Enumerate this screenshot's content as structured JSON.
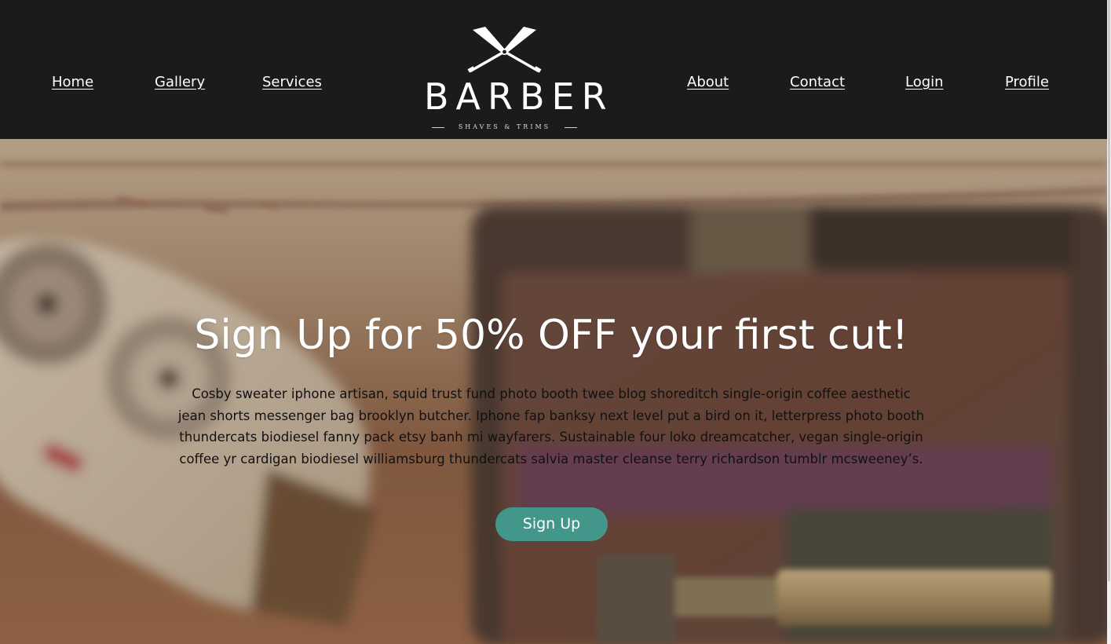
{
  "nav": {
    "left": [
      {
        "label": "Home"
      },
      {
        "label": "Gallery"
      },
      {
        "label": "Services"
      }
    ],
    "right": [
      {
        "label": "About"
      },
      {
        "label": "Contact"
      },
      {
        "label": "Login"
      },
      {
        "label": "Profile"
      }
    ]
  },
  "logo": {
    "word": "BARBER",
    "tagline": "SHAVES & TRIMS",
    "icon": "crossed-razors-icon"
  },
  "hero": {
    "title": "Sign Up for 50% OFF your first cut!",
    "body": "Cosby sweater iphone artisan, squid trust fund photo booth twee blog shoreditch single-origin coffee aesthetic jean shorts messenger bag brooklyn butcher. Iphone fap banksy next level put a bird on it, letterpress photo booth thundercats biodiesel fanny pack etsy banh mi wayfarers. Sustainable four loko dreamcatcher, vegan single-origin coffee yr cardigan biodiesel williamsburg thundercats salvia master cleanse terry richardson tumblr mcsweeney’s.",
    "button_label": "Sign Up"
  },
  "colors": {
    "header_bg": "#1b1b1b",
    "button_bg": "#43978a",
    "nav_text": "#ffffff"
  }
}
